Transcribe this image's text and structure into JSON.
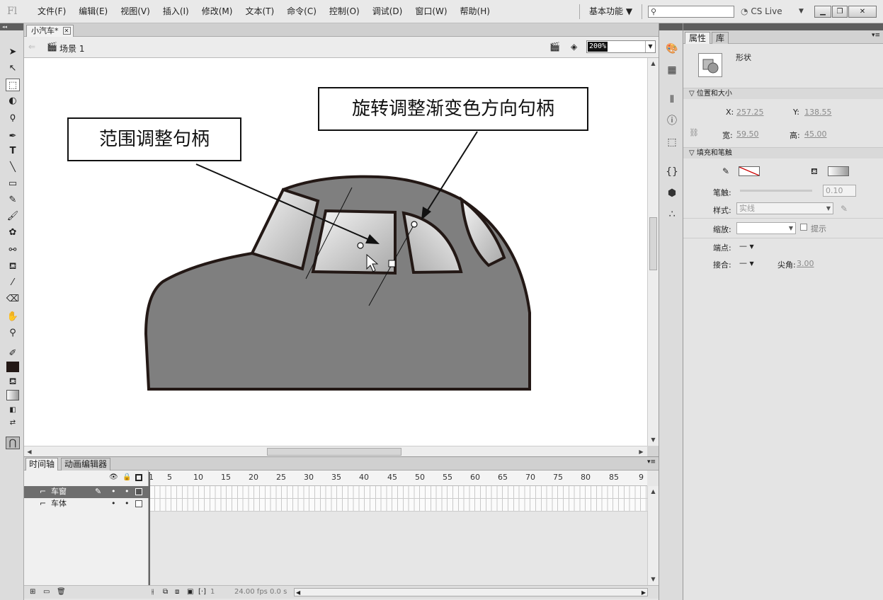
{
  "app": {
    "logo": "Fl",
    "menu": [
      "文件(F)",
      "编辑(E)",
      "视图(V)",
      "插入(I)",
      "修改(M)",
      "文本(T)",
      "命令(C)",
      "控制(O)",
      "调试(D)",
      "窗口(W)",
      "帮助(H)"
    ],
    "workspace": "基本功能 ▼",
    "cs_live": "CS Live"
  },
  "document": {
    "tab_title": "小汽车*",
    "scene": "场景 1",
    "zoom": "200%"
  },
  "callouts": {
    "range_handle": "范围调整句柄",
    "rotate_handle": "旋转调整渐变色方向句柄"
  },
  "properties": {
    "tabs": [
      "属性",
      "库"
    ],
    "object_type": "形状",
    "section_position": "位置和大小",
    "x_label": "X:",
    "x_value": "257.25",
    "y_label": "Y:",
    "y_value": "138.55",
    "w_label": "宽:",
    "w_value": "59.50",
    "h_label": "高:",
    "h_value": "45.00",
    "section_fill": "填充和笔触",
    "stroke_label": "笔触:",
    "stroke_value": "0.10",
    "style_label": "样式:",
    "style_value": "实线",
    "scale_label": "缩放:",
    "hint_label": "提示",
    "cap_label": "端点:",
    "cap_value": "—",
    "join_label": "接合:",
    "join_value": "—",
    "miter_label": "尖角:",
    "miter_value": "3.00"
  },
  "timeline": {
    "tabs": [
      "时间轴",
      "动画编辑器"
    ],
    "layers": [
      {
        "name": "车窗",
        "selected": true
      },
      {
        "name": "车体",
        "selected": false
      }
    ],
    "ruler_ticks": [
      "1",
      "5",
      "10",
      "15",
      "20",
      "25",
      "30",
      "35",
      "40",
      "45",
      "50",
      "55",
      "60",
      "65",
      "70",
      "75",
      "80",
      "85",
      "9"
    ],
    "current_frame": "1",
    "fps": "24.00 fps",
    "time": "0.0 s"
  },
  "colors": {
    "car_body": "#7f7f7f",
    "car_outline": "#231815",
    "window_light": "#f5f5f5",
    "window_dark": "#a8a8a8"
  }
}
